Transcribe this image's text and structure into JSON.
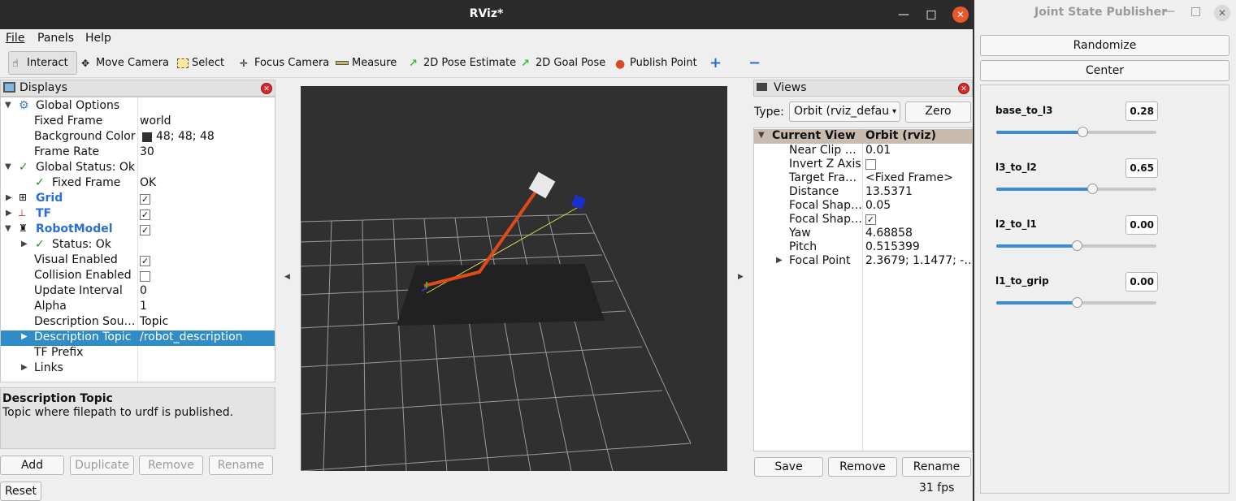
{
  "rviz": {
    "title": "RViz*",
    "menu": [
      "File",
      "Panels",
      "Help"
    ],
    "tools": [
      "Interact",
      "Move Camera",
      "Select",
      "Focus Camera",
      "Measure",
      "2D Pose Estimate",
      "2D Goal Pose",
      "Publish Point"
    ],
    "displays": {
      "header": "Displays",
      "rows": {
        "global_options": "Global Options",
        "fixed_frame": {
          "label": "Fixed Frame",
          "value": "world"
        },
        "background_color": {
          "label": "Background Color",
          "value": "48; 48; 48"
        },
        "frame_rate": {
          "label": "Frame Rate",
          "value": "30"
        },
        "global_status": "Global Status: Ok",
        "status_fixed_frame": {
          "label": "Fixed Frame",
          "value": "OK"
        },
        "grid": "Grid",
        "tf": "TF",
        "robot_model": "RobotModel",
        "status_ok": "Status: Ok",
        "visual_enabled": "Visual Enabled",
        "collision_enabled": "Collision Enabled",
        "update_interval": {
          "label": "Update Interval",
          "value": "0"
        },
        "alpha": {
          "label": "Alpha",
          "value": "1"
        },
        "description_source": {
          "label": "Description Sou…",
          "value": "Topic"
        },
        "description_topic": {
          "label": "Description Topic",
          "value": "/robot_description"
        },
        "tf_prefix": "TF Prefix",
        "links": "Links"
      },
      "help_title": "Description Topic",
      "help_text": "Topic where filepath to urdf is published.",
      "buttons": {
        "add": "Add",
        "duplicate": "Duplicate",
        "remove": "Remove",
        "rename": "Rename"
      },
      "reset": "Reset"
    },
    "views": {
      "header": "Views",
      "type_label": "Type:",
      "type_value": "Orbit (rviz_defau",
      "zero": "Zero",
      "col1": "Current View",
      "col2": "Orbit (rviz)",
      "props": [
        {
          "label": "Near Clip …",
          "value": "0.01"
        },
        {
          "label": "Invert Z Axis",
          "value": ""
        },
        {
          "label": "Target Fra…",
          "value": "<Fixed Frame>"
        },
        {
          "label": "Distance",
          "value": "13.5371"
        },
        {
          "label": "Focal Shap…",
          "value": "0.05"
        },
        {
          "label": "Focal Shap…",
          "value": ""
        },
        {
          "label": "Yaw",
          "value": "4.68858"
        },
        {
          "label": "Pitch",
          "value": "0.515399"
        },
        {
          "label": "Focal Point",
          "value": "2.3679; 1.1477; -…"
        }
      ],
      "buttons": {
        "save": "Save",
        "remove": "Remove",
        "rename": "Rename"
      },
      "fps": "31 fps"
    }
  },
  "jsp": {
    "title": "Joint State Publisher",
    "randomize": "Randomize",
    "center": "Center",
    "joints": [
      {
        "name": "base_to_l3",
        "value": "0.28",
        "level": 0.54
      },
      {
        "name": "l3_to_l2",
        "value": "0.65",
        "level": 0.6
      },
      {
        "name": "l2_to_l1",
        "value": "0.00",
        "level": 0.5
      },
      {
        "name": "l1_to_grip",
        "value": "0.00",
        "level": 0.5
      }
    ]
  }
}
